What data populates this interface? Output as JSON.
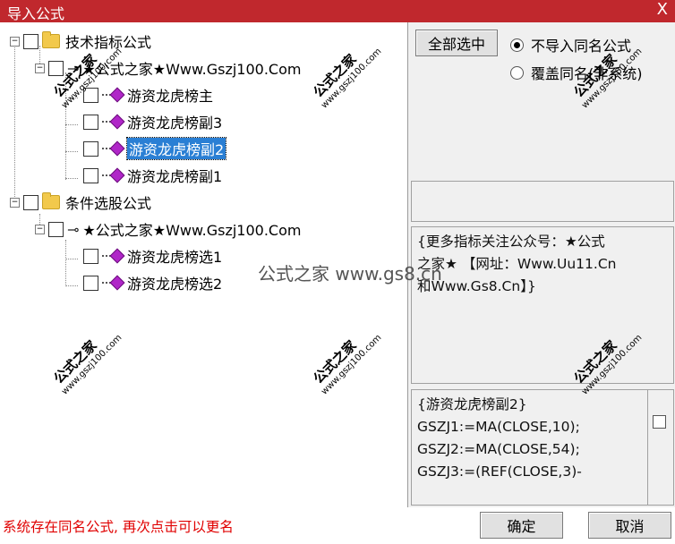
{
  "window": {
    "title": "导入公式",
    "close_label": "X"
  },
  "tree": {
    "groups": [
      {
        "label": "技术指标公式",
        "sub_label": "★公式之家★Www.Gszj100.Com",
        "items": [
          "游资龙虎榜主",
          "游资龙虎榜副3",
          "游资龙虎榜副2",
          "游资龙虎榜副1"
        ],
        "selected_index": 2
      },
      {
        "label": "条件选股公式",
        "sub_label": "★公式之家★Www.Gszj100.Com",
        "items": [
          "游资龙虎榜选1",
          "游资龙虎榜选2"
        ]
      }
    ]
  },
  "options": {
    "select_all_label": "全部选中",
    "no_import_label": "不导入同名公式",
    "overwrite_label": "覆盖同名(非系统)",
    "selected": "no_import"
  },
  "description": {
    "line1": "{更多指标关注公众号：★公式",
    "line2": "之家★ 【网址：Www.Uu11.Cn",
    "line3": "和Www.Gs8.Cn】}"
  },
  "code_preview": {
    "line1": "{游资龙虎榜副2}",
    "line2": "GSZJ1:=MA(CLOSE,10);",
    "line3": "GSZJ2:=MA(CLOSE,54);",
    "line4": "GSZJ3:=(REF(CLOSE,3)-"
  },
  "watermarks": {
    "text": "公式之家",
    "url": "www.gszj100.com",
    "center": "公式之家 www.gs8.cn"
  },
  "footer": {
    "status": "系统存在同名公式, 再次点击可以更名",
    "ok_label": "确定",
    "cancel_label": "取消"
  }
}
